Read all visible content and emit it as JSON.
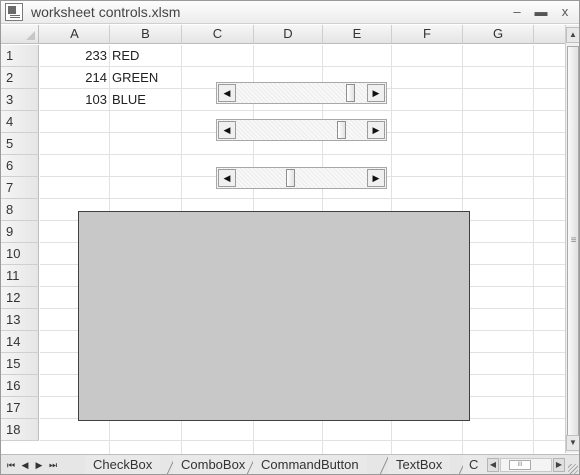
{
  "window": {
    "title": "worksheet controls.xlsm",
    "minimize_glyph": "–",
    "maximize_glyph": "▬",
    "close_glyph": "x"
  },
  "columns": [
    "A",
    "B",
    "C",
    "D",
    "E",
    "F",
    "G"
  ],
  "rows": [
    "1",
    "2",
    "3",
    "4",
    "5",
    "6",
    "7",
    "8",
    "9",
    "10",
    "11",
    "12",
    "13",
    "14",
    "15",
    "16",
    "17",
    "18"
  ],
  "cells": {
    "A1": "233",
    "B1": "RED",
    "A2": "214",
    "B2": "GREEN",
    "A3": "103",
    "B3": "BLUE"
  },
  "scrollbars": [
    {
      "name": "red",
      "value": 233,
      "max": 255
    },
    {
      "name": "green",
      "value": 214,
      "max": 255
    },
    {
      "name": "blue",
      "value": 103,
      "max": 255
    }
  ],
  "preview": {
    "color": "#c8c8c8"
  },
  "sheet_tabs": [
    "CheckBox",
    "ComboBox",
    "CommandButton",
    "TextBox",
    "C"
  ],
  "icons": {
    "scroll_left": "◀",
    "scroll_right": "▶",
    "scroll_up": "▲",
    "scroll_down": "▼",
    "first_sheet": "⏮",
    "prev_sheet": "◀",
    "next_sheet": "▶",
    "last_sheet": "⏭"
  },
  "colors": {
    "header_bg": "#e6e6e6",
    "grid_line": "#e1e1e1",
    "preview_border": "#404040"
  }
}
